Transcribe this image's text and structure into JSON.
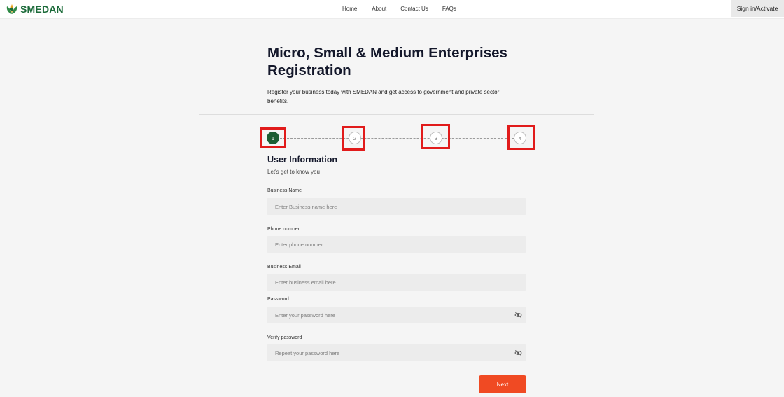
{
  "brand": {
    "name": "SMEDAN",
    "logo_icon": "smedan-leaf-icon",
    "color": "#1c6b3a"
  },
  "nav": {
    "items": [
      {
        "label": "Home"
      },
      {
        "label": "About"
      },
      {
        "label": "Contact Us"
      },
      {
        "label": "FAQs"
      }
    ],
    "signin_label": "Sign in/Activate"
  },
  "header": {
    "title": "Micro, Small & Medium Enterprises Registration",
    "intro": "Register your business today with SMEDAN and get access to government and private sector benefits."
  },
  "stepper": {
    "active_step": 1,
    "active_color": "#1e5e34",
    "highlight_color": "#e11b1b",
    "steps": [
      {
        "label": "1"
      },
      {
        "label": "2"
      },
      {
        "label": "3"
      },
      {
        "label": "4"
      }
    ]
  },
  "section": {
    "title": "User Information",
    "subtitle": "Let's get to know you"
  },
  "form": {
    "business_name": {
      "label": "Business Name",
      "placeholder": "Enter Business name here",
      "value": ""
    },
    "phone": {
      "label": "Phone number",
      "placeholder": "Enter phone number",
      "value": ""
    },
    "email": {
      "label": "Business Email",
      "placeholder": "Enter business email here",
      "value": ""
    },
    "password": {
      "label": "Password",
      "placeholder": "Enter your password here",
      "value": "",
      "toggle_icon": "eye-slash-icon"
    },
    "verify_password": {
      "label": "Verify password",
      "placeholder": "Repeat your password here",
      "value": "",
      "toggle_icon": "eye-slash-icon"
    },
    "next_label": "Next",
    "next_color": "#f04a23"
  }
}
